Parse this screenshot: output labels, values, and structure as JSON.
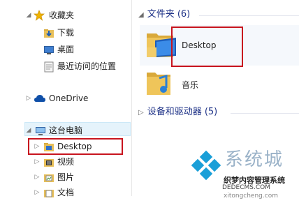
{
  "nav": {
    "favorites": {
      "label": "收藏夹"
    },
    "fav_items": [
      {
        "label": "下载"
      },
      {
        "label": "桌面"
      },
      {
        "label": "最近访问的位置"
      }
    ],
    "onedrive": {
      "label": "OneDrive"
    },
    "this_pc": {
      "label": "这台电脑"
    },
    "pc_items": [
      {
        "label": "Desktop"
      },
      {
        "label": "视频"
      },
      {
        "label": "图片"
      },
      {
        "label": "文档"
      }
    ]
  },
  "main": {
    "folders_header": "文件夹 (6)",
    "folders": [
      {
        "name": "Desktop"
      },
      {
        "name": "音乐"
      }
    ],
    "devices_header": "设备和驱动器 (5)"
  },
  "watermark": {
    "brand": "系统城",
    "cn_text": "织梦内容管理系统",
    "url": "DEDECMS.COM",
    "url2": "xitongcheng.com"
  },
  "colors": {
    "highlight_box": "#c8141e",
    "group_header": "#1e3287",
    "selected_bg": "#e5f3fb"
  }
}
